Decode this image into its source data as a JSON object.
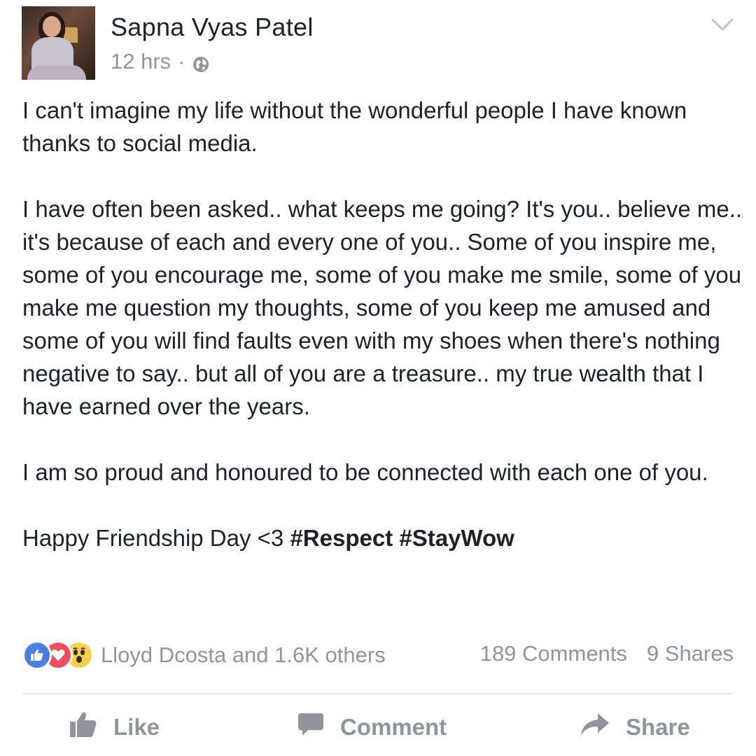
{
  "post": {
    "author": "Sapna Vyas Patel",
    "time": "12 hrs",
    "separator": "·",
    "privacy_icon": "globe-icon",
    "menu_icon": "chevron-down-icon",
    "paragraphs": [
      "I can't imagine my life without the wonderful people I have known thanks to social media.",
      "I have often been asked.. what keeps me going? It's you.. believe me.. it's because of each and every one of you.. Some of you inspire me, some of you encourage me, some of you make me smile, some of you make me question my thoughts, some of you keep me amused and some of you will find faults even with my shoes when there's nothing negative to say.. but all of you are a treasure.. my true wealth that I have earned over the years.",
      "I am so proud and honoured to be connected with each one of you."
    ],
    "closing_text": "Happy Friendship Day <3 ",
    "hashtags": [
      "#Respect",
      "#StayWow"
    ]
  },
  "reactions": {
    "icons": [
      "like-reaction-icon",
      "love-reaction-icon",
      "wow-reaction-icon"
    ],
    "summary": "Lloyd Dcosta and 1.6K others",
    "comments": "189 Comments",
    "shares": "9 Shares"
  },
  "actions": {
    "like": "Like",
    "comment": "Comment",
    "share": "Share"
  },
  "colors": {
    "text": "#1d2129",
    "muted": "#90949c",
    "like_blue": "#4a7fe0",
    "love_red": "#f04d5e",
    "wow_yellow": "#f7cf4a",
    "divider": "#e5e6e9"
  }
}
